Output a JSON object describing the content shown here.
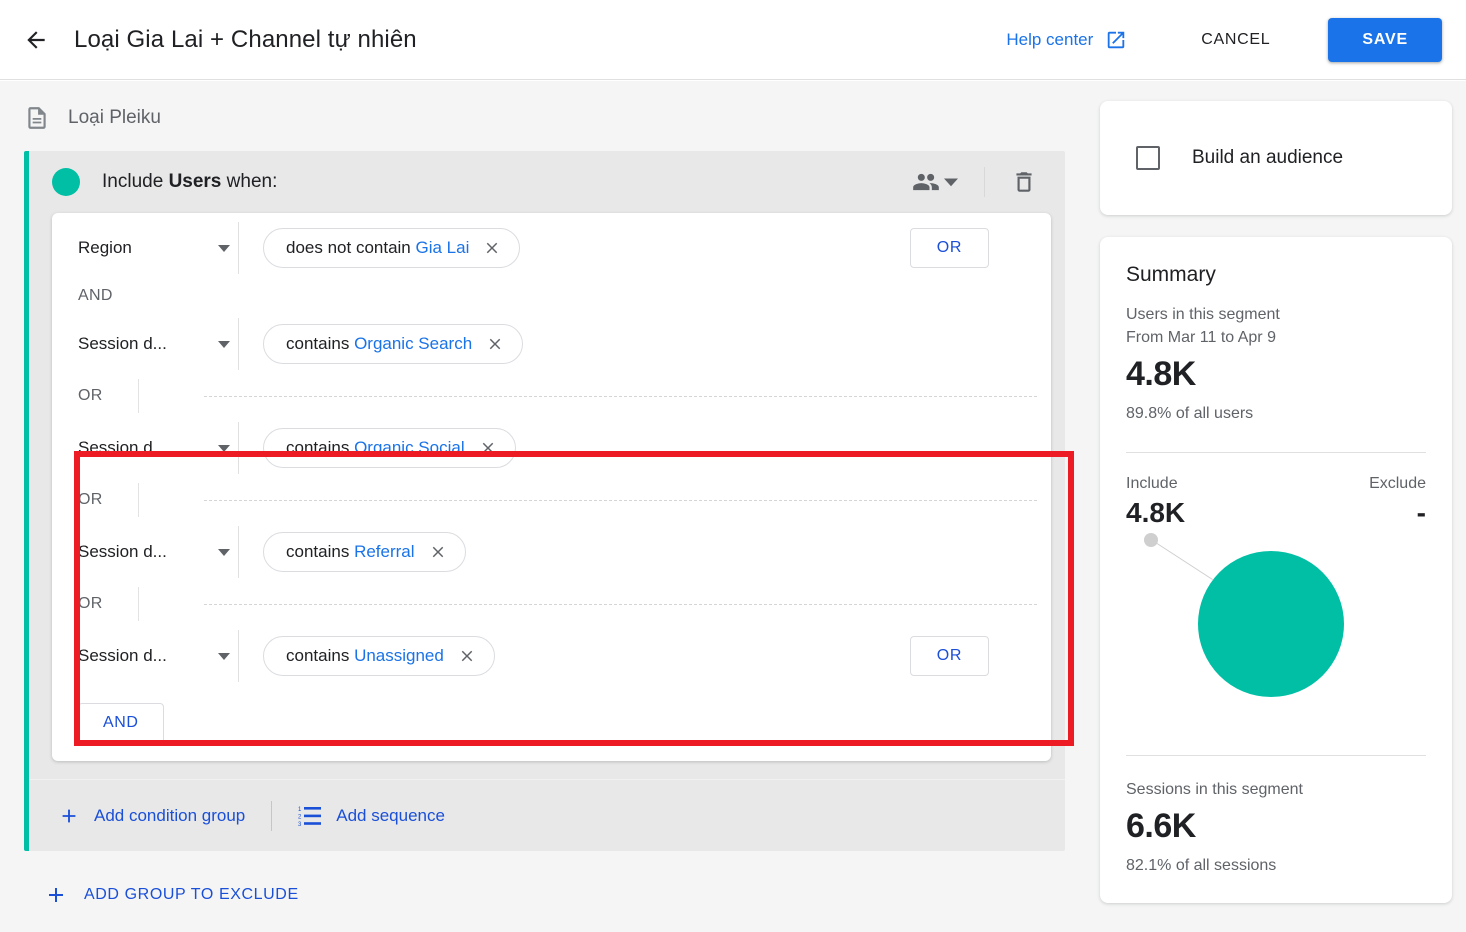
{
  "header": {
    "back_icon": "arrow-left-icon",
    "title": "Loại Gia Lai + Channel tự nhiên",
    "help_center_label": "Help center",
    "help_center_icon": "open-in-new-icon",
    "cancel_label": "CANCEL",
    "save_label": "SAVE",
    "accent_blue": "#1a73e8"
  },
  "segment": {
    "doc_icon": "document-icon",
    "name": "Loại Pleiku"
  },
  "builder": {
    "rail_color": "#00bfa5",
    "include_prefix": "Include",
    "include_scope": "Users",
    "include_suffix": "when:",
    "scope_icon": "people-icon",
    "scope_caret_icon": "chevron-down-icon",
    "delete_icon": "trash-icon",
    "and_button_label": "AND",
    "or_button_label": "OR",
    "and_separator_label": "AND",
    "or_separator_label": "OR",
    "conditions": [
      {
        "dimension": "Region",
        "operator": "does not contain",
        "value": "Gia Lai",
        "remove_icon": "close-icon",
        "has_or_button": true
      },
      {
        "dimension": "Session d...",
        "operator": "contains",
        "value": "Organic Search",
        "remove_icon": "close-icon",
        "has_or_button": false
      },
      {
        "dimension": "Session d...",
        "operator": "contains",
        "value": "Organic Social",
        "remove_icon": "close-icon",
        "has_or_button": false
      },
      {
        "dimension": "Session d...",
        "operator": "contains",
        "value": "Referral",
        "remove_icon": "close-icon",
        "has_or_button": false
      },
      {
        "dimension": "Session d...",
        "operator": "contains",
        "value": "Unassigned",
        "remove_icon": "close-icon",
        "has_or_button": true
      }
    ],
    "group_actions": [
      {
        "icon": "plus-icon",
        "label": "Add condition group"
      },
      {
        "icon": "numbered-list-icon",
        "label": "Add sequence"
      }
    ],
    "add_group_to_exclude": {
      "icon": "plus-icon",
      "label": "ADD GROUP TO EXCLUDE"
    },
    "highlight_color": "#ed1c24"
  },
  "right_panel": {
    "audience": {
      "checkbox_state": "unchecked",
      "label": "Build an audience"
    },
    "summary": {
      "title": "Summary",
      "users_caption_line1": "Users in this segment",
      "users_caption_line2": "From Mar 11 to Apr 9",
      "users_value": "4.8K",
      "users_percent": "89.8% of all users",
      "include_label": "Include",
      "exclude_label": "Exclude",
      "include_value": "4.8K",
      "exclude_value": "-",
      "venn_color": "#00bfa5",
      "sessions_caption": "Sessions in this segment",
      "sessions_value": "6.6K",
      "sessions_percent": "82.1% of all sessions"
    }
  }
}
